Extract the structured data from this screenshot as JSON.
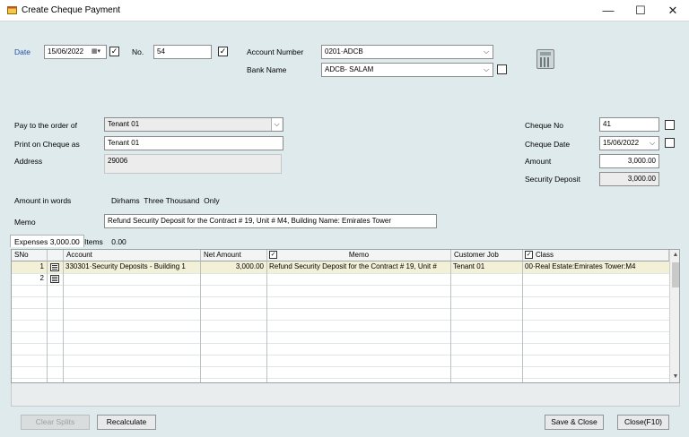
{
  "window": {
    "title": "Create Cheque Payment",
    "minimize": "—",
    "maximize": "☐",
    "close": "✕"
  },
  "header": {
    "date_label": "Date",
    "date_value": "15/06/2022",
    "no_label": "No.",
    "no_value": "54",
    "account_number_label": "Account Number",
    "account_number_value": "0201·ADCB",
    "bank_name_label": "Bank Name",
    "bank_name_value": "ADCB- SALAM"
  },
  "payee": {
    "pay_to_label": "Pay to the order of",
    "pay_to_value": "Tenant 01",
    "print_on_cheque_label": "Print on Cheque as",
    "print_on_cheque_value": "Tenant 01",
    "address_label": "Address",
    "address_value": "29006"
  },
  "cheque": {
    "cheque_no_label": "Cheque No",
    "cheque_no_value": "41",
    "cheque_date_label": "Cheque Date",
    "cheque_date_value": "15/06/2022",
    "amount_label": "Amount",
    "amount_value": "3,000.00",
    "security_deposit_label": "Security Deposit",
    "security_deposit_value": "3,000.00"
  },
  "amount_in_words": {
    "label": "Amount in words",
    "value": "Dirhams  Three Thousand  Only"
  },
  "memo": {
    "label": "Memo",
    "value": "Refund Security Deposit for the Contract # 19, Unit # M4, Building Name: Emirates Tower"
  },
  "tabs": [
    {
      "label": "Expenses 3,000.00"
    },
    {
      "label": "Items    0.00"
    }
  ],
  "grid": {
    "columns": [
      "SNo",
      "",
      "Account",
      "Net Amount",
      "Memo",
      "Customer Job",
      "Class"
    ],
    "rows": [
      {
        "sno": "1",
        "account": "330301·Security Deposits - Building 1",
        "net_amount": "3,000.00",
        "memo": "Refund Security Deposit for the Contract # 19, Unit #",
        "customer_job": "Tenant 01",
        "class": "00·Real Estate:Emirates Tower:M4"
      },
      {
        "sno": "2",
        "account": "",
        "net_amount": "",
        "memo": "",
        "customer_job": "",
        "class": ""
      }
    ]
  },
  "buttons": {
    "clear_splits": "Clear Splits",
    "recalculate": "Recalculate",
    "save_close": "Save & Close",
    "close": "Close(F10)"
  },
  "icons": {
    "app": "app-window-icon",
    "calendar": "calendar-icon",
    "calculator": "calculator-icon",
    "dropdown": "chevron-down-icon",
    "row": "split-row-icon"
  },
  "colors": {
    "background": "#dfeaec",
    "label_blue": "#1f4f9f",
    "row_highlight": "#f2f0d6"
  }
}
